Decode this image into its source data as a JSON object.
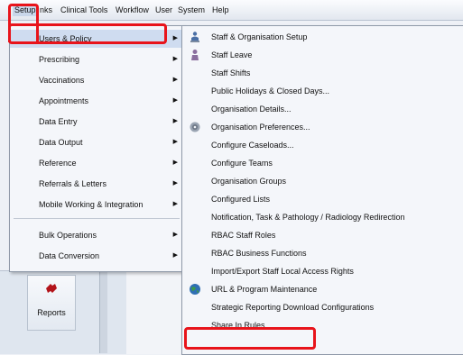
{
  "menubar": {
    "items": [
      "Setup",
      "Clinics",
      "Clinical Tools",
      "Workflow",
      "User",
      "System",
      "Help"
    ],
    "active_visible": "Setup",
    "clinics_visible": "nks"
  },
  "main_menu": {
    "items": [
      {
        "label": "Users & Policy",
        "submenu": true
      },
      {
        "label": "Prescribing",
        "submenu": true
      },
      {
        "label": "Vaccinations",
        "submenu": true
      },
      {
        "label": "Appointments",
        "submenu": true
      },
      {
        "label": "Data Entry",
        "submenu": true
      },
      {
        "label": "Data Output",
        "submenu": true
      },
      {
        "label": "Reference",
        "submenu": true
      },
      {
        "label": "Referrals & Letters",
        "submenu": true
      },
      {
        "label": "Mobile Working & Integration",
        "submenu": true
      },
      {
        "label": "Bulk Operations",
        "submenu": true
      },
      {
        "label": "Data Conversion",
        "submenu": true
      }
    ]
  },
  "submenu": {
    "items": [
      {
        "label": "Staff & Organisation Setup",
        "icon": "staff-org-icon"
      },
      {
        "label": "Staff Leave",
        "icon": "person-icon"
      },
      {
        "label": "Staff Shifts",
        "icon": ""
      },
      {
        "label": "Public Holidays & Closed Days...",
        "icon": ""
      },
      {
        "label": "Organisation Details...",
        "icon": ""
      },
      {
        "label": "Organisation Preferences...",
        "icon": "gear-icon"
      },
      {
        "label": "Configure Caseloads...",
        "icon": ""
      },
      {
        "label": "Configure Teams",
        "icon": ""
      },
      {
        "label": "Organisation Groups",
        "icon": ""
      },
      {
        "label": "Configured Lists",
        "icon": ""
      },
      {
        "label": "Notification, Task & Pathology / Radiology Redirection",
        "icon": ""
      },
      {
        "label": "RBAC Staff Roles",
        "icon": ""
      },
      {
        "label": "RBAC Business Functions",
        "icon": ""
      },
      {
        "label": "Import/Export Staff Local Access Rights",
        "icon": ""
      },
      {
        "label": "URL & Program Maintenance",
        "icon": "globe-icon"
      },
      {
        "label": "Strategic Reporting Download Configurations",
        "icon": ""
      },
      {
        "label": "Share In Rules...",
        "icon": ""
      }
    ]
  },
  "background": {
    "reports_label": "Reports"
  },
  "colors": {
    "highlight": "#e8141b",
    "selection": "#cfdcf0"
  }
}
